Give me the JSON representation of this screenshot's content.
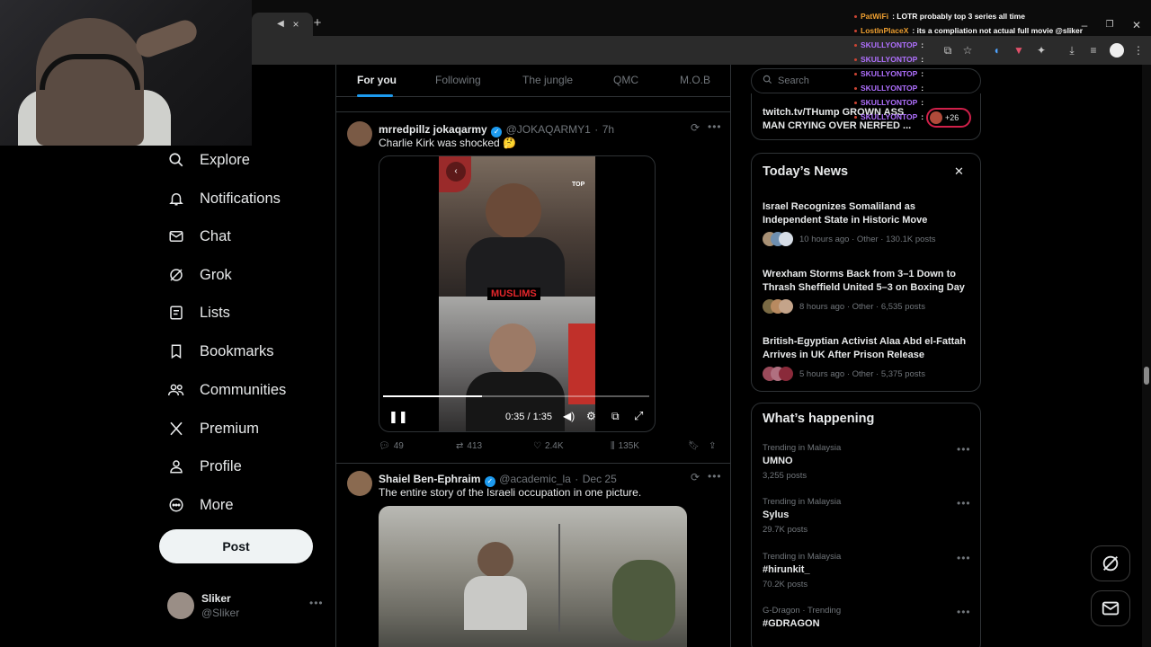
{
  "browser": {
    "close_tab": "×",
    "new_tab": "+"
  },
  "sidebar": {
    "items": [
      {
        "label": "Explore",
        "icon": "search-icon"
      },
      {
        "label": "Notifications",
        "icon": "bell-icon"
      },
      {
        "label": "Chat",
        "icon": "mail-icon"
      },
      {
        "label": "Grok",
        "icon": "grok-icon"
      },
      {
        "label": "Lists",
        "icon": "list-icon"
      },
      {
        "label": "Bookmarks",
        "icon": "bookmark-icon"
      },
      {
        "label": "Communities",
        "icon": "people-icon"
      },
      {
        "label": "Premium",
        "icon": "x-logo-icon"
      },
      {
        "label": "Profile",
        "icon": "person-icon"
      },
      {
        "label": "More",
        "icon": "more-circle-icon"
      }
    ],
    "post_label": "Post",
    "account": {
      "name": "Sliker",
      "handle": "@Sliker"
    }
  },
  "feed": {
    "tabs": [
      "For you",
      "Following",
      "The jungle",
      "QMC",
      "M.O.B"
    ],
    "tweets": [
      {
        "name": "mrredpillz jokaqarmy",
        "handle": "@JOKAQARMY1",
        "time": "7h",
        "text": "Charlie Kirk was shocked 🤔",
        "video_overlay": "MUSLIMS",
        "video_time": "0:35 / 1:35",
        "video_progress": 0.37,
        "replies": "49",
        "reposts": "413",
        "likes": "2.4K",
        "views": "135K"
      },
      {
        "name": "Shaiel Ben-Ephraim",
        "handle": "@academic_la",
        "time": "Dec 25",
        "text": "The entire story of the Israeli occupation in one picture."
      }
    ]
  },
  "right": {
    "search_placeholder": "Search",
    "live": {
      "title": "twitch.tv/THump GROWN ASS MAN CRYING OVER NERFED ...",
      "count": "+26"
    },
    "todays_news": {
      "title": "Today’s News",
      "items": [
        {
          "headline": "Israel Recognizes Somaliland as Independent State in Historic Move",
          "meta": "10 hours ago · Other · 130.1K posts"
        },
        {
          "headline": "Wrexham Storms Back from 3–1 Down to Thrash Sheffield United 5–3 on Boxing Day",
          "meta": "8 hours ago · Other · 6,535 posts"
        },
        {
          "headline": "British-Egyptian Activist Alaa Abd el-Fattah Arrives in UK After Prison Release",
          "meta": "5 hours ago · Other · 5,375 posts"
        }
      ]
    },
    "whats_happening": {
      "title": "What’s happening",
      "trends": [
        {
          "context": "Trending in Malaysia",
          "name": "UMNO",
          "posts": "3,255 posts"
        },
        {
          "context": "Trending in Malaysia",
          "name": "Sylus",
          "posts": "29.7K posts"
        },
        {
          "context": "Trending in Malaysia",
          "name": "#hirunkit_",
          "posts": "70.2K posts"
        },
        {
          "context": "G-Dragon · Trending",
          "name": "#GDRAGON",
          "posts": ""
        }
      ]
    }
  },
  "chat": [
    {
      "user": "PatWiFi",
      "color": "#f0a030",
      "msg": ": LOTR probably top 3 series all time"
    },
    {
      "user": "LostInPlaceX",
      "color": "#f0a030",
      "msg": ": its a compliation not actual full movie @sliker"
    },
    {
      "user": "SKULLYONTOP",
      "color": "#b070ff",
      "msg": ":"
    },
    {
      "user": "SKULLYONTOP",
      "color": "#b070ff",
      "msg": ":"
    },
    {
      "user": "SKULLYONTOP",
      "color": "#b070ff",
      "msg": ":"
    },
    {
      "user": "SKULLYONTOP",
      "color": "#b070ff",
      "msg": ":"
    },
    {
      "user": "SKULLYONTOP",
      "color": "#b070ff",
      "msg": ":"
    },
    {
      "user": "SKULLYONTOP",
      "color": "#b070ff",
      "msg": ":"
    }
  ]
}
